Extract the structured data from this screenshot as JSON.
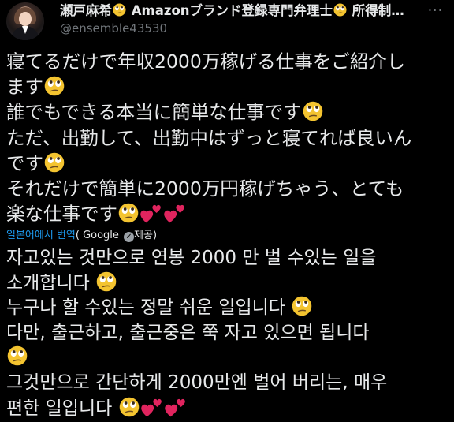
{
  "author": {
    "display_name_part1": "瀬戸麻希",
    "display_name_part2": " Amazonブランド登録専門弁理士",
    "display_name_part3": " 所得制…",
    "handle": "@ensemble43530"
  },
  "menu": {
    "more_label": "···"
  },
  "tweet": {
    "lines": [
      "寝てるだけで年収2000万稼げる仕事をご紹介し",
      "ます",
      "誰でもできる本当に簡単な仕事です",
      "ただ、出勤して、出勤中はずっと寝てれば良いん",
      "です",
      "それだけで簡単に2000万円稼げちゃう、とても",
      "楽な仕事です"
    ]
  },
  "translation": {
    "link_label": "일본어에서 번역",
    "provider_prefix": "( Google",
    "provider_suffix": "제공)",
    "lines": [
      "자고있는 것만으로 연봉 2000 만 벌 수있는 일을",
      "소개합니다",
      "누구나 할 수있는 정말 쉬운 일입니다",
      "다만, 출근하고, 출근중은 쭉 자고 있으면 됩니다",
      "",
      "그것만으로 간단하게 2000만엔 벌어 버리는, 매우",
      "편한 일입니다"
    ]
  },
  "icons": {
    "emoji": "rolling-eyes-face",
    "hearts": "two-hearts",
    "check": "check-badge"
  },
  "colors": {
    "background": "#000000",
    "text": "#e7e9ea",
    "secondary": "#71767b",
    "link": "#1d9bf0",
    "emoji_face": "#f4c430",
    "heart": "#e0245e"
  }
}
